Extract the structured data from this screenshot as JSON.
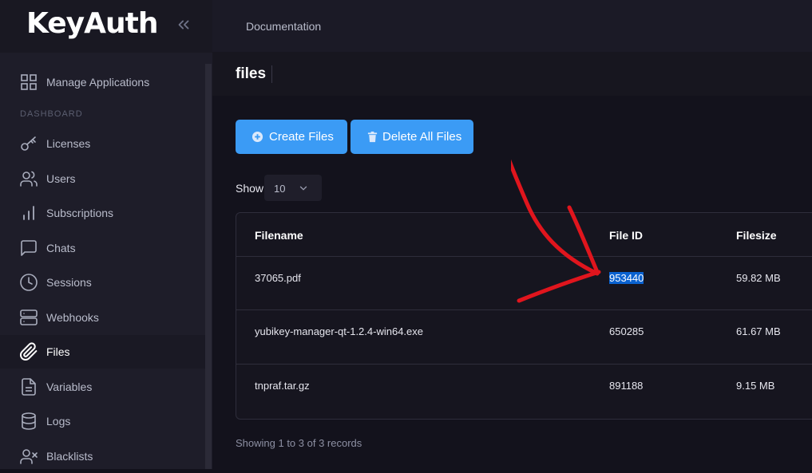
{
  "brand": {
    "logo_text": "KeyAuth"
  },
  "topbar": {
    "documentation_link": "Documentation"
  },
  "sidebar": {
    "top_item": "Manage Applications",
    "section_label": "DASHBOARD",
    "items": [
      {
        "label": "Licenses",
        "icon": "key-icon"
      },
      {
        "label": "Users",
        "icon": "users-icon"
      },
      {
        "label": "Subscriptions",
        "icon": "bar-chart-icon"
      },
      {
        "label": "Chats",
        "icon": "chat-icon"
      },
      {
        "label": "Sessions",
        "icon": "clock-icon"
      },
      {
        "label": "Webhooks",
        "icon": "server-icon"
      },
      {
        "label": "Files",
        "icon": "paperclip-icon",
        "active": true
      },
      {
        "label": "Variables",
        "icon": "file-text-icon"
      },
      {
        "label": "Logs",
        "icon": "database-icon"
      },
      {
        "label": "Blacklists",
        "icon": "user-x-icon"
      }
    ]
  },
  "page": {
    "title": "files"
  },
  "actions": {
    "create_label": "Create Files",
    "delete_label": "Delete All Files"
  },
  "table_controls": {
    "show_label": "Show",
    "page_size": "10"
  },
  "table": {
    "columns": [
      "Filename",
      "File ID",
      "Filesize"
    ],
    "rows": [
      {
        "filename": "37065.pdf",
        "file_id": "953440",
        "filesize": "59.82 MB"
      },
      {
        "filename": "yubikey-manager-qt-1.2.4-win64.exe",
        "file_id": "650285",
        "filesize": "61.67 MB"
      },
      {
        "filename": "tnpraf.tar.gz",
        "file_id": "891188",
        "filesize": "9.15 MB"
      }
    ]
  },
  "footer": {
    "records_text": "Showing 1 to 3 of 3 records"
  },
  "colors": {
    "accent": "#3b9bf5",
    "annotation": "#e0151d",
    "selection": "#0a62d0"
  }
}
